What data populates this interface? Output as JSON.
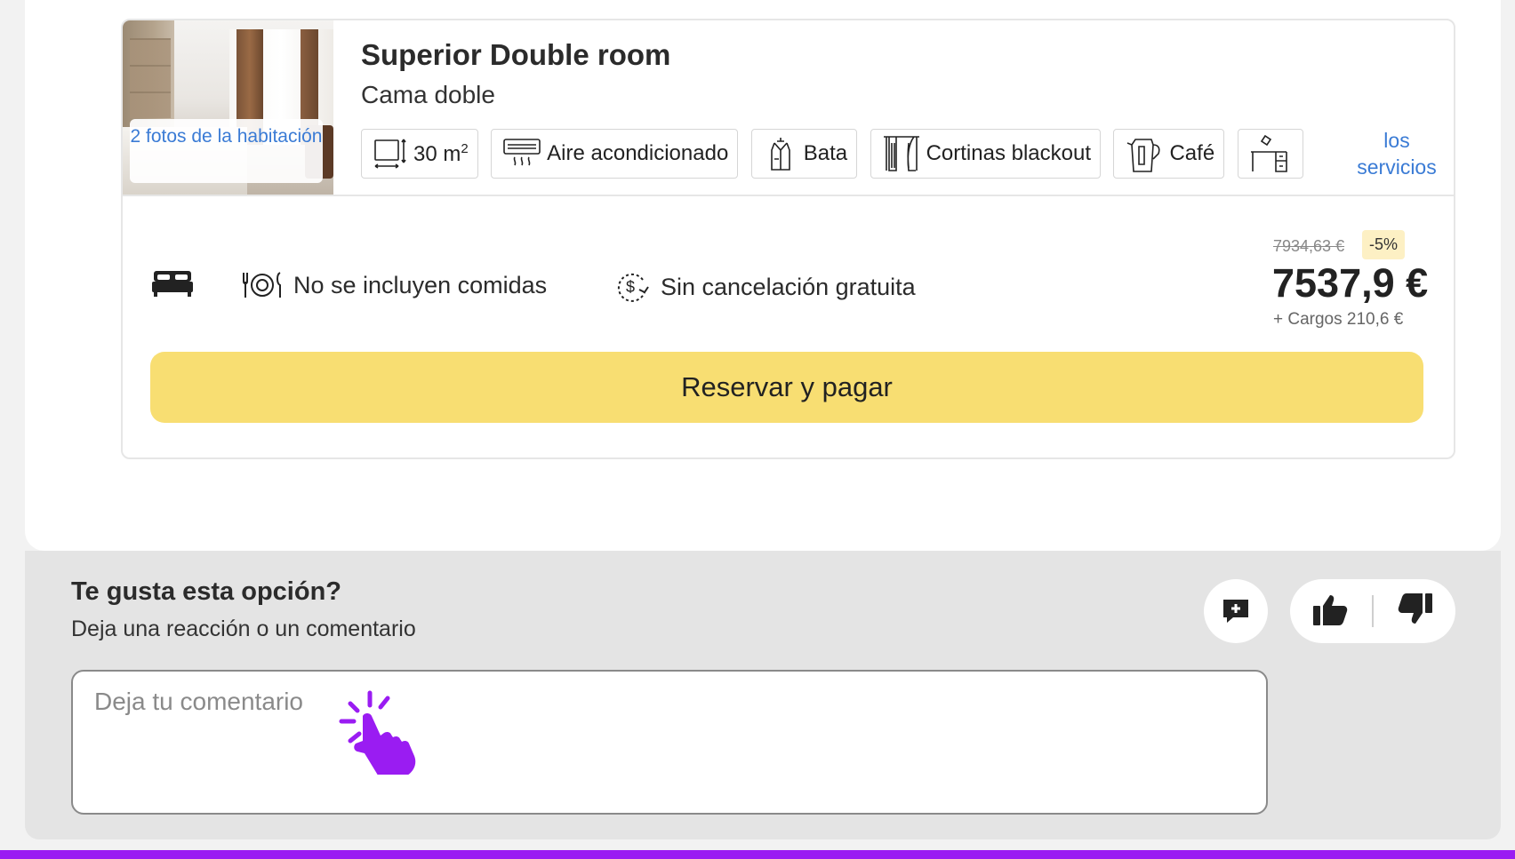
{
  "room": {
    "photo_badge": "2 fotos de la habitación",
    "title": "Superior Double room",
    "bed_type": "Cama doble",
    "amenities": {
      "area_value": "30 m",
      "area_sup": "2",
      "ac": "Aire acondicionado",
      "robe": "Bata",
      "blackout": "Cortinas blackout",
      "coffee": "Café"
    },
    "services_link": "los servicios"
  },
  "offer": {
    "meals": "No se incluyen comidas",
    "cancellation": "Sin cancelación gratuita",
    "old_price": "7934,63 €",
    "discount": "-5%",
    "price": "7537,9 €",
    "fees": "+ Cargos 210,6 €",
    "book_button": "Reservar y pagar"
  },
  "feedback": {
    "title": "Te gusta esta opción?",
    "subtitle": "Deja una reacción o un comentario",
    "comment_placeholder": "Deja tu comentario"
  },
  "icons": {
    "bed": "bed-icon",
    "meal": "plate-cutlery-icon",
    "cancel": "refund-icon",
    "comment": "add-comment-icon",
    "like": "thumbs-up-icon",
    "dislike": "thumbs-down-icon",
    "cursor": "click-hand-icon"
  },
  "colors": {
    "accent_button": "#f8de72",
    "link": "#3a7bd5",
    "discount_bg": "#fdf0c4",
    "cursor": "#9a1cf2"
  }
}
